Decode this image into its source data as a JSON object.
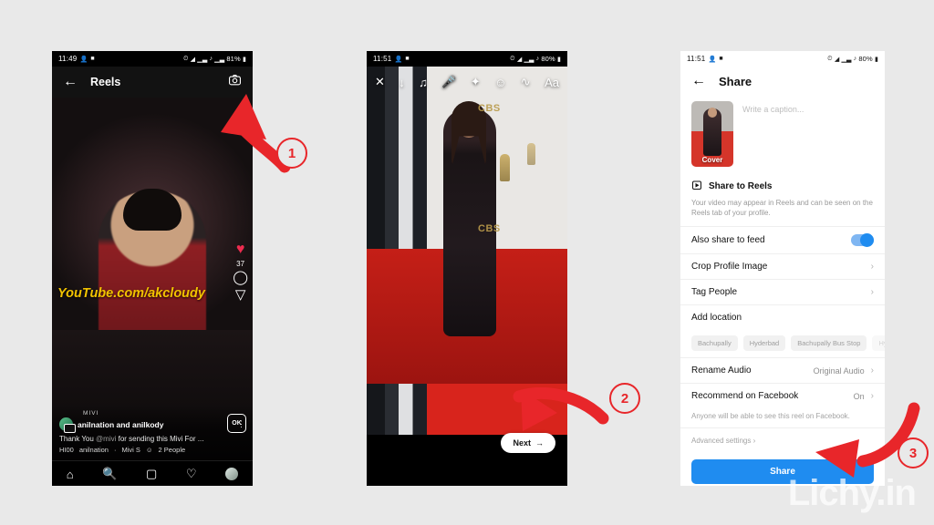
{
  "background_color": "#e9e9e9",
  "accent_red": "#e8262a",
  "accent_blue": "#1f8cf0",
  "watermark": "Lichy.in",
  "phone1": {
    "status": {
      "time": "11:49",
      "battery": "81%",
      "icons": [
        "person-icon",
        "image-icon",
        "alarm-icon",
        "wifi-icon",
        "signal-icon",
        "mute-icon",
        "signal2-icon"
      ]
    },
    "header": {
      "back": "←",
      "title": "Reels",
      "camera": "camera-icon"
    },
    "video": {
      "watermark_text": "YouTube.com/akcloudy"
    },
    "rail": {
      "like_icon": "♥",
      "like_count": "37",
      "comment_icon": "comment-icon",
      "share_icon": "share-icon"
    },
    "meta": {
      "brand": "MIVI",
      "username": "anilnation and anilkody",
      "more": "⋮",
      "caption": "Thank You ",
      "caption_mention": "@mivi",
      "caption_rest": " for sending this Mivi For ...",
      "audio": "HI00",
      "audio_author": "anilnation",
      "audio_sep": "·",
      "audio_track": "Mivi S",
      "people": "2 People",
      "badge": "OK"
    },
    "tabs": [
      "home-icon",
      "search-icon",
      "reels-icon",
      "heart-icon",
      "profile-avatar"
    ]
  },
  "phone2": {
    "status": {
      "time": "11:51",
      "battery": "80%"
    },
    "toolbar": [
      "close-icon",
      "download-icon",
      "music-icon",
      "microphone-icon",
      "sparkle-icon",
      "sticker-icon",
      "draw-icon",
      "text-icon"
    ],
    "toolbar_text_label": "Aa",
    "photo": {
      "logo1": "CBS",
      "logo2": "CBS"
    },
    "next_button": {
      "label": "Next",
      "arrow": "→"
    }
  },
  "phone3": {
    "status": {
      "time": "11:51",
      "battery": "80%"
    },
    "header": {
      "back": "←",
      "title": "Share"
    },
    "caption": {
      "cover_label": "Cover",
      "placeholder": "Write a caption..."
    },
    "section": {
      "icon": "reels-icon",
      "title": "Share to Reels",
      "description": "Your video may appear in Reels and can be seen on the Reels tab of your profile."
    },
    "rows": [
      {
        "label": "Also share to feed",
        "control": "toggle",
        "value": "on"
      },
      {
        "label": "Crop Profile Image",
        "control": "chevron",
        "value": ""
      },
      {
        "label": "Tag People",
        "control": "chevron",
        "value": ""
      },
      {
        "label": "Add location",
        "control": "none",
        "value": ""
      }
    ],
    "location_chips": [
      "Bachupally",
      "Hyderbad",
      "Bachupally Bus Stop",
      "Hyd"
    ],
    "rows2": [
      {
        "label": "Rename Audio",
        "value": "Original Audio",
        "control": "chevron"
      },
      {
        "label": "Recommend on Facebook",
        "value": "On",
        "control": "chevron"
      }
    ],
    "facebook_note": "Anyone will be able to see this reel on Facebook.",
    "advanced": "Advanced settings ›",
    "share_button": "Share"
  },
  "annotations": {
    "step1": "1",
    "step2": "2",
    "step3": "3"
  }
}
